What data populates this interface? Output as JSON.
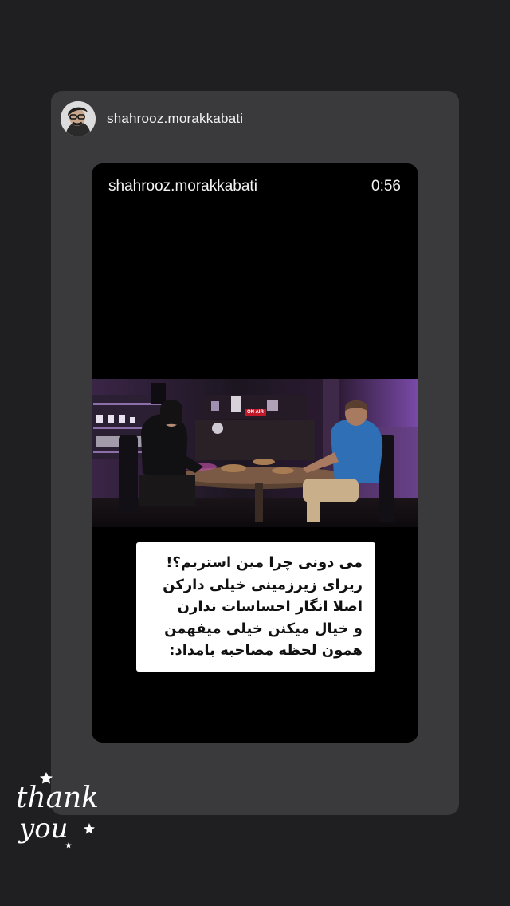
{
  "post": {
    "author": "shahrooz.morakkabati"
  },
  "reel": {
    "username": "shahrooz.morakkabati",
    "duration": "0:56",
    "on_air_sign": "ON AIR",
    "caption_lines": [
      "می دونی چرا مین استریم؟!",
      "ریرای زیرزمینی خیلی دارکن",
      "اصلا انگار احساسات ندارن",
      "و خیال میکنن خیلی میفهمن",
      "همون لحظه مصاحبه بامداد:"
    ]
  },
  "sticker": {
    "line1": "thank",
    "line2": "you",
    "color": "#ffffff"
  },
  "colors": {
    "background": "#1f1f21",
    "card": "#3a3a3d",
    "reel": "#000000",
    "caption_bg": "#ffffff",
    "purple_glow": "#7a4aa8",
    "shirt_blue": "#2f6fb5"
  }
}
